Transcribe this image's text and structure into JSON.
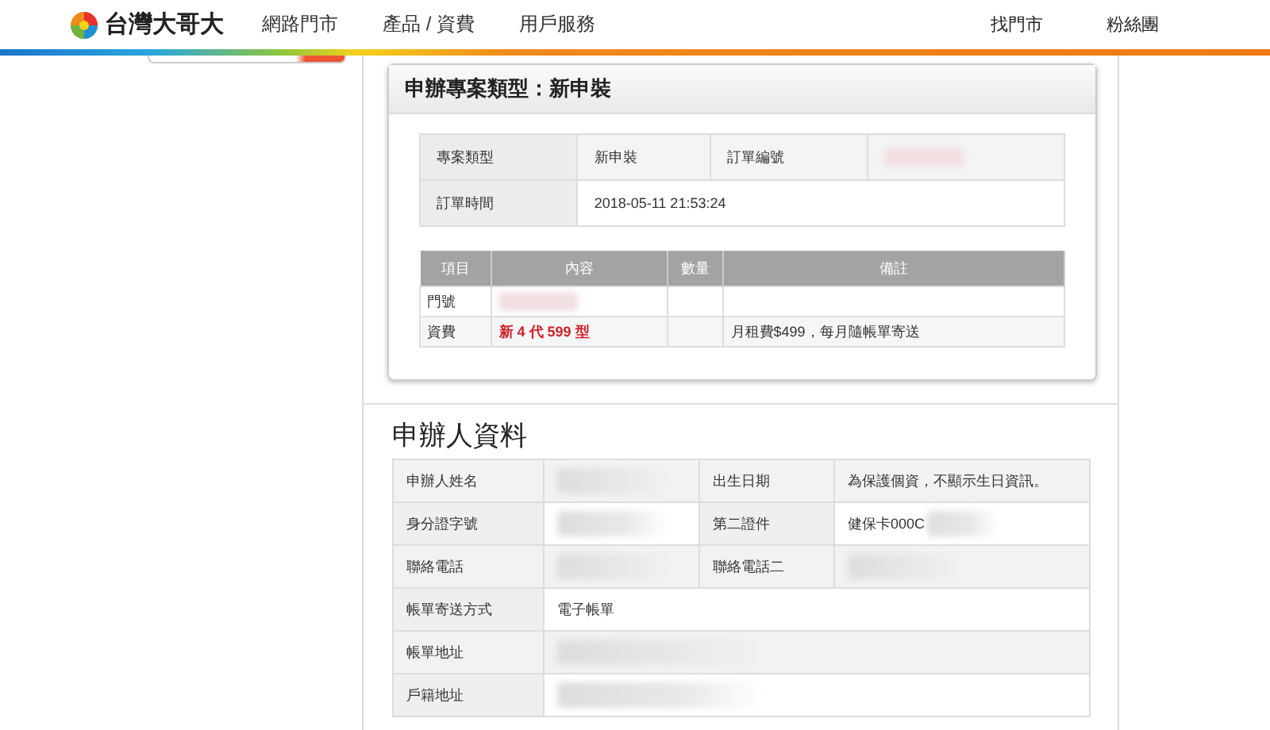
{
  "header": {
    "logo": "台灣大哥大",
    "nav": [
      "網路門市",
      "產品 / 資費",
      "用戶服務"
    ],
    "utility_links": [
      "找門市",
      "粉絲團"
    ]
  },
  "project": {
    "title": "申辦專案類型：新申裝",
    "info_rows": [
      [
        {
          "kind": "label",
          "text": "專案類型"
        },
        {
          "kind": "value",
          "text": "新申裝"
        },
        {
          "kind": "label",
          "text": "訂單編號"
        },
        {
          "kind": "redacted"
        }
      ],
      [
        {
          "kind": "label",
          "text": "訂單時間"
        },
        {
          "kind": "value",
          "text": "2018-05-11 21:53:24",
          "colspan": 3
        }
      ]
    ],
    "items": {
      "columns": [
        "項目",
        "內容",
        "數量",
        "備註"
      ],
      "rows": [
        {
          "item": "門號",
          "content": {
            "kind": "redacted"
          }
        },
        {
          "item": "資費",
          "content": {
            "kind": "highlight",
            "text": "新 4 代 599 型"
          },
          "note": "月租費$499，每月隨帳單寄送"
        }
      ]
    }
  },
  "applicant": {
    "title": "申辦人資料",
    "rows": [
      [
        {
          "kind": "label",
          "text": "申辦人姓名"
        },
        {
          "kind": "redacted"
        },
        {
          "kind": "label",
          "text": "出生日期"
        },
        {
          "kind": "value",
          "text": "為保護個資，不顯示生日資訊。"
        }
      ],
      [
        {
          "kind": "label",
          "text": "身分證字號"
        },
        {
          "kind": "redacted"
        },
        {
          "kind": "label",
          "text": "第二證件"
        },
        {
          "kind": "partial",
          "text": "健保卡000C"
        }
      ],
      [
        {
          "kind": "label",
          "text": "聯絡電話"
        },
        {
          "kind": "redacted"
        },
        {
          "kind": "label",
          "text": "聯絡電話二"
        },
        {
          "kind": "redacted"
        }
      ],
      [
        {
          "kind": "label",
          "text": "帳單寄送方式"
        },
        {
          "kind": "value",
          "text": "電子帳單",
          "colspan": 3
        }
      ],
      [
        {
          "kind": "label",
          "text": "帳單地址"
        },
        {
          "kind": "redacted",
          "colspan": 3
        }
      ],
      [
        {
          "kind": "label",
          "text": "戶籍地址"
        },
        {
          "kind": "redacted",
          "colspan": 3
        }
      ]
    ]
  }
}
